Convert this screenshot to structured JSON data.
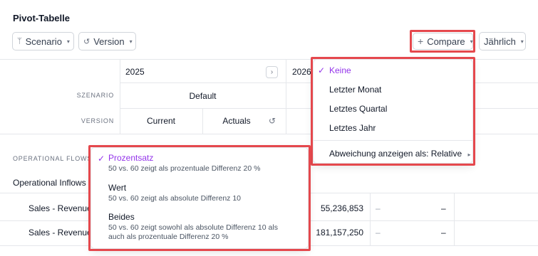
{
  "title": "Pivot-Tabelle",
  "toolbar": {
    "scenario_label": "Scenario",
    "version_label": "Version",
    "compare_label": "Compare",
    "period_label": "Jährlich",
    "plus": "+",
    "branch_icon": "ᛘ",
    "history_icon": "↺",
    "chevron": "▾"
  },
  "header": {
    "year_main": "2025",
    "year_partial": "2026",
    "next_icon": "›",
    "row_labels": {
      "scenario": "SZENARIO",
      "version": "VERSION"
    },
    "scenario_value": "Default",
    "version_values": [
      "Current",
      "Actuals"
    ],
    "history_icon": "↺"
  },
  "table": {
    "section_label": "OPERATIONAL FLOWS",
    "group_row": "Operational Inflows",
    "rows": [
      {
        "name": "Sales - Revenue",
        "value": "55,236,853",
        "c1": "–",
        "c2": "–"
      },
      {
        "name": "Sales - Revenue",
        "value": "181,157,250",
        "c1": "–",
        "c2": "–"
      }
    ]
  },
  "compare_menu": {
    "check": "✓",
    "items": [
      "Keine",
      "Letzter Monat",
      "Letztes Quartal",
      "Letztes Jahr"
    ],
    "selected_index": 0,
    "deviation_label": "Abweichung anzeigen als: Relative",
    "submenu_arrow": "▸"
  },
  "deviation_menu": {
    "check": "✓",
    "items": [
      {
        "label": "Prozentsatz",
        "desc": "50 vs. 60 zeigt als prozentuale Differenz 20 %",
        "selected": true
      },
      {
        "label": "Wert",
        "desc": "50 vs. 60 zeigt als absolute Differenz 10",
        "selected": false
      },
      {
        "label": "Beides",
        "desc": "50 vs. 60 zeigt sowohl als absolute Differenz 10 als auch als prozentuale Differenz 20 %",
        "selected": false
      }
    ]
  },
  "colors": {
    "accent": "#9333ea",
    "highlight": "#e5484d"
  }
}
